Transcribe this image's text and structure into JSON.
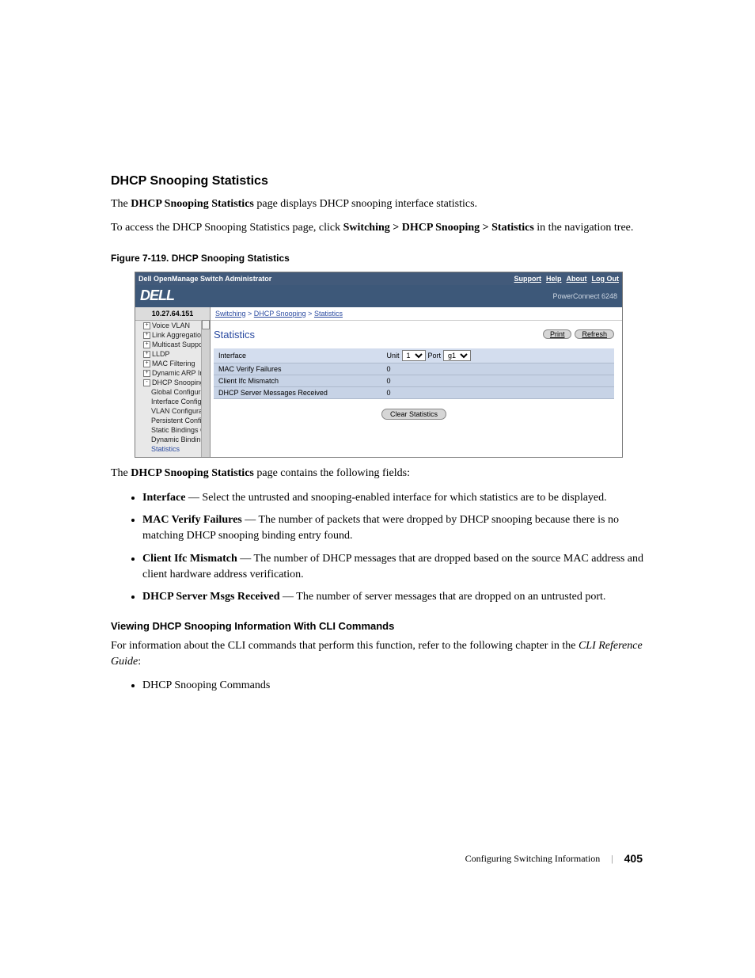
{
  "section_title": "DHCP Snooping Statistics",
  "intro_1_prefix": "The ",
  "intro_1_bold": "DHCP Snooping Statistics",
  "intro_1_suffix": " page displays DHCP snooping interface statistics.",
  "intro_2_prefix": "To access the DHCP Snooping Statistics page, click ",
  "intro_2_bold": "Switching > DHCP Snooping > Statistics",
  "intro_2_suffix": " in the navigation tree.",
  "figure_caption": "Figure 7-119.    DHCP Snooping Statistics",
  "shot": {
    "topbar_title": "Dell OpenManage Switch Administrator",
    "links": [
      "Support",
      "Help",
      "About",
      "Log Out"
    ],
    "brand": "DELL",
    "model": "PowerConnect 6248",
    "ip": "10.27.64.151",
    "nav_items": [
      {
        "label": "Voice VLAN",
        "lvl": 1,
        "icon": "+"
      },
      {
        "label": "Link Aggregation",
        "lvl": 1,
        "icon": "+"
      },
      {
        "label": "Multicast Support",
        "lvl": 1,
        "icon": "+"
      },
      {
        "label": "LLDP",
        "lvl": 1,
        "icon": "+"
      },
      {
        "label": "MAC Filtering",
        "lvl": 1,
        "icon": "+"
      },
      {
        "label": "Dynamic ARP Inspe",
        "lvl": 1,
        "icon": "+"
      },
      {
        "label": "DHCP Snooping",
        "lvl": 1,
        "icon": "-"
      },
      {
        "label": "Global Configurat",
        "lvl": 2,
        "icon": ""
      },
      {
        "label": "Interface Configu",
        "lvl": 2,
        "icon": ""
      },
      {
        "label": "VLAN Configurati",
        "lvl": 2,
        "icon": ""
      },
      {
        "label": "Persistent Config",
        "lvl": 2,
        "icon": ""
      },
      {
        "label": "Static Bindings C",
        "lvl": 2,
        "icon": ""
      },
      {
        "label": "Dynamic Binding",
        "lvl": 2,
        "icon": ""
      },
      {
        "label": "Statistics",
        "lvl": 2,
        "icon": "",
        "sel": true
      }
    ],
    "crumb_a": "Switching",
    "crumb_b": "DHCP Snooping",
    "crumb_c": "Statistics",
    "panel_title": "Statistics",
    "print": "Print",
    "refresh": "Refresh",
    "row_interface": "Interface",
    "unit_label": "Unit",
    "unit_value": "1",
    "port_label": "Port",
    "port_value": "g1",
    "row_mac": "MAC Verify Failures",
    "row_mac_val": "0",
    "row_client": "Client Ifc Mismatch",
    "row_client_val": "0",
    "row_dhcp": "DHCP Server Messages Received",
    "row_dhcp_val": "0",
    "clear_btn": "Clear Statistics"
  },
  "fields_intro_prefix": "The ",
  "fields_intro_bold": "DHCP Snooping Statistics",
  "fields_intro_suffix": " page contains the following fields:",
  "bullets": [
    {
      "term": "Interface",
      "desc": " — Select the untrusted and snooping-enabled interface for which statistics are to be displayed."
    },
    {
      "term": "MAC Verify Failures",
      "desc": " — The number of packets that were dropped by DHCP snooping because there is no matching DHCP snooping binding entry found."
    },
    {
      "term": "Client Ifc Mismatch",
      "desc": " — The number of DHCP messages that are dropped based on the source MAC address and client hardware address verification."
    },
    {
      "term": "DHCP Server Msgs Received",
      "desc": " — The number of server messages that are dropped on an untrusted port."
    }
  ],
  "cli_heading": "Viewing DHCP Snooping Information With CLI Commands",
  "cli_para_prefix": "For information about the CLI commands that perform this function, refer to the following chapter in the ",
  "cli_para_ital": "CLI Reference Guide",
  "cli_para_suffix": ":",
  "cli_bullet": "DHCP Snooping Commands",
  "footer_text": "Configuring Switching Information",
  "footer_page": "405"
}
